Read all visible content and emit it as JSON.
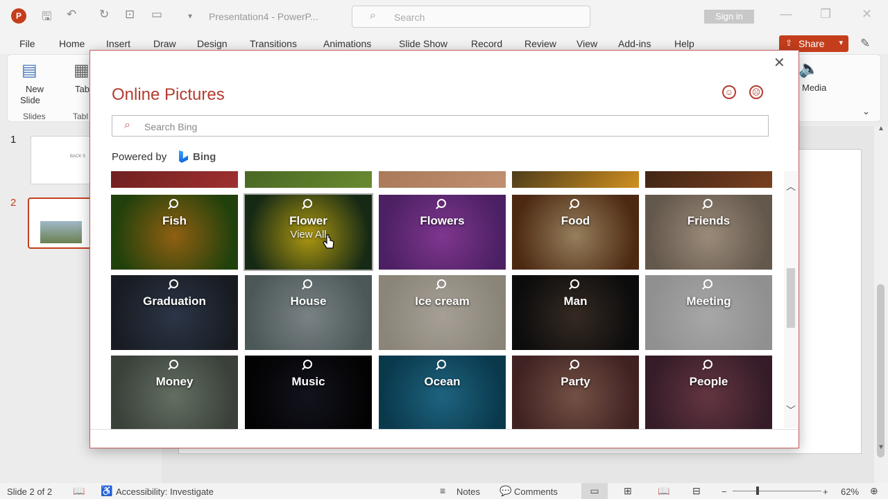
{
  "titlebar": {
    "doc_title": "Presentation4  -  PowerP...",
    "search_placeholder": "Search",
    "signin": "Sign in",
    "app_logo": "P"
  },
  "menu": [
    "File",
    "Home",
    "Insert",
    "Draw",
    "Design",
    "Transitions",
    "Animations",
    "Slide Show",
    "Record",
    "Review",
    "View",
    "Add-ins",
    "Help"
  ],
  "share_label": "Share",
  "ribbon": {
    "new_slide_1": "New",
    "new_slide_2": "Slide",
    "slides_group": "Slides",
    "table_label": "Tab",
    "table_group": "Tabl",
    "media_label": "Media"
  },
  "thumbnails": [
    {
      "num": "1",
      "text": "BACK S"
    },
    {
      "num": "2",
      "text": ""
    }
  ],
  "dialog": {
    "title": "Online Pictures",
    "search_placeholder": "Search Bing",
    "powered_by": "Powered by",
    "bing": "Bing",
    "close": "✕",
    "smile": "☺",
    "frown": "☹"
  },
  "tiles": [
    {
      "label": "Fish",
      "color1": "#2d5a10",
      "color2": "#c8851a"
    },
    {
      "label": "Flower",
      "sub": "View All",
      "color1": "#1e3a1c",
      "color2": "#f0d21a"
    },
    {
      "label": "Flowers",
      "color1": "#6a2d8a",
      "color2": "#b04bc6"
    },
    {
      "label": "Food",
      "color1": "#6b3a1a",
      "color2": "#d0b080"
    },
    {
      "label": "Friends",
      "color1": "#8a7a6a",
      "color2": "#d6c0a8"
    },
    {
      "label": "Graduation",
      "color1": "#222830",
      "color2": "#3d4a63"
    },
    {
      "label": "House",
      "color1": "#6a7a7a",
      "color2": "#a8b4b8"
    },
    {
      "label": "Ice cream",
      "color1": "#c0b8a8",
      "color2": "#e6ddd0"
    },
    {
      "label": "Man",
      "color1": "#111111",
      "color2": "#4a3a30"
    },
    {
      "label": "Meeting",
      "color1": "#c8c8c8",
      "color2": "#e8e8e8"
    },
    {
      "label": "Money",
      "color1": "#505a50",
      "color2": "#8a9a88"
    },
    {
      "label": "Music",
      "color1": "#050505",
      "color2": "#1a1a2a"
    },
    {
      "label": "Ocean",
      "color1": "#0e4f6a",
      "color2": "#2a8ab0"
    },
    {
      "label": "Party",
      "color1": "#5a3030",
      "color2": "#a07060"
    },
    {
      "label": "People",
      "color1": "#4a2838",
      "color2": "#8a4a5a"
    }
  ],
  "status": {
    "slide": "Slide 2 of 2",
    "accessibility": "Accessibility: Investigate",
    "notes": "Notes",
    "comments": "Comments",
    "zoom": "62%"
  }
}
